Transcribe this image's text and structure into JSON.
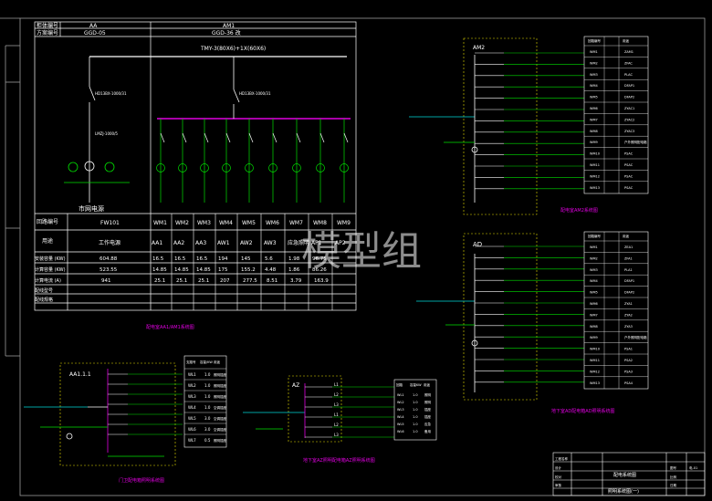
{
  "watermark": "模型组",
  "colors": {
    "background": "#000000",
    "line_white": "#ffffff",
    "line_green": "#00e000",
    "line_magenta": "#e000e0",
    "line_cyan": "#00d8d8",
    "line_yellow": "#e8e000",
    "frame_gray": "#9a9a9a"
  },
  "main_panel": {
    "header_rows": [
      {
        "label": "柜体编号",
        "col1": "AA",
        "col2": "AM1"
      },
      {
        "label": "方案编号",
        "col1": "GGD-05",
        "col2": "GGD-36  改"
      }
    ],
    "busbar_label": "TMY-3(80X6)+1X(60X6)",
    "incomer_breaker": "HD13BX-1000/31",
    "incomer_ct": "LMZJ-1000/5",
    "incomer_label": "市网电源",
    "main_breaker": "HD13BX-1000/31",
    "rows": {
      "circuit_no_label": "回路编号",
      "use_label": "用途",
      "installed_label": "安装容量  (KW)",
      "calc_label": "计算容量  (KW)",
      "current_label": "计算电流  (A)",
      "cable_label": "配线型号",
      "breaker_label": "配线规格"
    },
    "circuits": [
      "FW101",
      "WM1",
      "WM2",
      "WM3",
      "WM4",
      "WM5",
      "WM6",
      "WM7",
      "WM8",
      "WM9"
    ],
    "uses": [
      "工作电源",
      "AA1",
      "AA2",
      "AA3",
      "AW1",
      "AW2",
      "AW3",
      "应急照明",
      "AP1",
      "AP2"
    ],
    "installed": [
      "604.88",
      "16.5",
      "16.5",
      "16.5",
      "194",
      "145",
      "5.6",
      "1.98",
      "96.75"
    ],
    "calculated": [
      "523.55",
      "14.85",
      "14.85",
      "14.85",
      "175",
      "155.2",
      "4.48",
      "1.86",
      "86.26"
    ],
    "current": [
      "941",
      "25.1",
      "25.1",
      "25.1",
      "207",
      "277.5",
      "8.51",
      "3.79",
      "163.9"
    ],
    "main_panel_caption": "配电室AA1/AM1系统图"
  },
  "am2_panel": {
    "title": "AM2",
    "circuit_header": "回路编号",
    "use_header": "用途",
    "rows": [
      {
        "no": "WM1",
        "use": "ZAM1"
      },
      {
        "no": "WM2",
        "use": "ZFAC"
      },
      {
        "no": "WM3",
        "use": "PLAC"
      },
      {
        "no": "WM4",
        "use": "DFAP1"
      },
      {
        "no": "WM5",
        "use": "DFAP2"
      },
      {
        "no": "WM6",
        "use": "ZYAC1"
      },
      {
        "no": "WM7",
        "use": "ZYAC2"
      },
      {
        "no": "WM8",
        "use": "ZYAC3"
      },
      {
        "no": "WM9",
        "use": "户外照明配电箱"
      },
      {
        "no": "WM10",
        "use": "PSAC"
      },
      {
        "no": "WM11",
        "use": "PSAC"
      },
      {
        "no": "WM12",
        "use": "PSAC"
      },
      {
        "no": "WM13",
        "use": "PSAC"
      }
    ],
    "caption": "配电室AM2系统图"
  },
  "ad_panel": {
    "title": "AD",
    "circuit_header": "回路编号",
    "use_header": "用途",
    "rows": [
      {
        "no": "WM1",
        "use": "ZEA1"
      },
      {
        "no": "WM2",
        "use": "ZFA1"
      },
      {
        "no": "WM3",
        "use": "PLA1"
      },
      {
        "no": "WM4",
        "use": "DFAP1"
      },
      {
        "no": "WM5",
        "use": "DFAP2"
      },
      {
        "no": "WM6",
        "use": "ZYA1"
      },
      {
        "no": "WM7",
        "use": "ZYA2"
      },
      {
        "no": "WM8",
        "use": "ZYA3"
      },
      {
        "no": "WM9",
        "use": "户外照明配电箱"
      },
      {
        "no": "WM10",
        "use": "PSA1"
      },
      {
        "no": "WM11",
        "use": "PSA2"
      },
      {
        "no": "WM12",
        "use": "PSA3"
      },
      {
        "no": "WM13",
        "use": "PSA4"
      }
    ],
    "caption": "地下室AD配电箱AD照明系统图"
  },
  "aa1_panel": {
    "title": "AA1.1.1",
    "table_headers": [
      "支路号",
      "容量/KW",
      "用途"
    ],
    "rows": [
      {
        "no": "WL1",
        "kw": "1.0",
        "use": "照明插座"
      },
      {
        "no": "WL2",
        "kw": "1.0",
        "use": "照明插座"
      },
      {
        "no": "WL3",
        "kw": "1.0",
        "use": "照明插座"
      },
      {
        "no": "WL4",
        "kw": "1.0",
        "use": "空调插座"
      },
      {
        "no": "WL5",
        "kw": "3.0",
        "use": "空调插座"
      },
      {
        "no": "WL6",
        "kw": "3.0",
        "use": "空调插座"
      },
      {
        "no": "WL7",
        "kw": "0.5",
        "use": "照明插座"
      }
    ],
    "caption": "门卫配电箱照明系统图"
  },
  "az_panel": {
    "title": "AZ",
    "phases": [
      "L1",
      "L2",
      "L3",
      "L1",
      "L2",
      "L3"
    ],
    "table_headers": [
      "回路",
      "容量KW",
      "用途"
    ],
    "rows": [
      {
        "no": "WL1",
        "kw": "1.0",
        "use": "照明"
      },
      {
        "no": "WL2",
        "kw": "1.0",
        "use": "照明"
      },
      {
        "no": "WL3",
        "kw": "1.0",
        "use": "插座"
      },
      {
        "no": "WL4",
        "kw": "1.0",
        "use": "插座"
      },
      {
        "no": "WL5",
        "kw": "1.0",
        "use": "应急"
      },
      {
        "no": "WL6",
        "kw": "1.0",
        "use": "备用"
      }
    ],
    "caption": "地下室AZ照明配电箱AZ照明系统图"
  },
  "title_block": {
    "drawing_name": "配电系统图",
    "sub_name": "照明系统图(一)",
    "rows": [
      "工程名称",
      "设计",
      "校对",
      "审核"
    ],
    "sheet_label": "图号",
    "sheet_value": "电-01",
    "scale_label": "比例",
    "date_label": "日期"
  }
}
